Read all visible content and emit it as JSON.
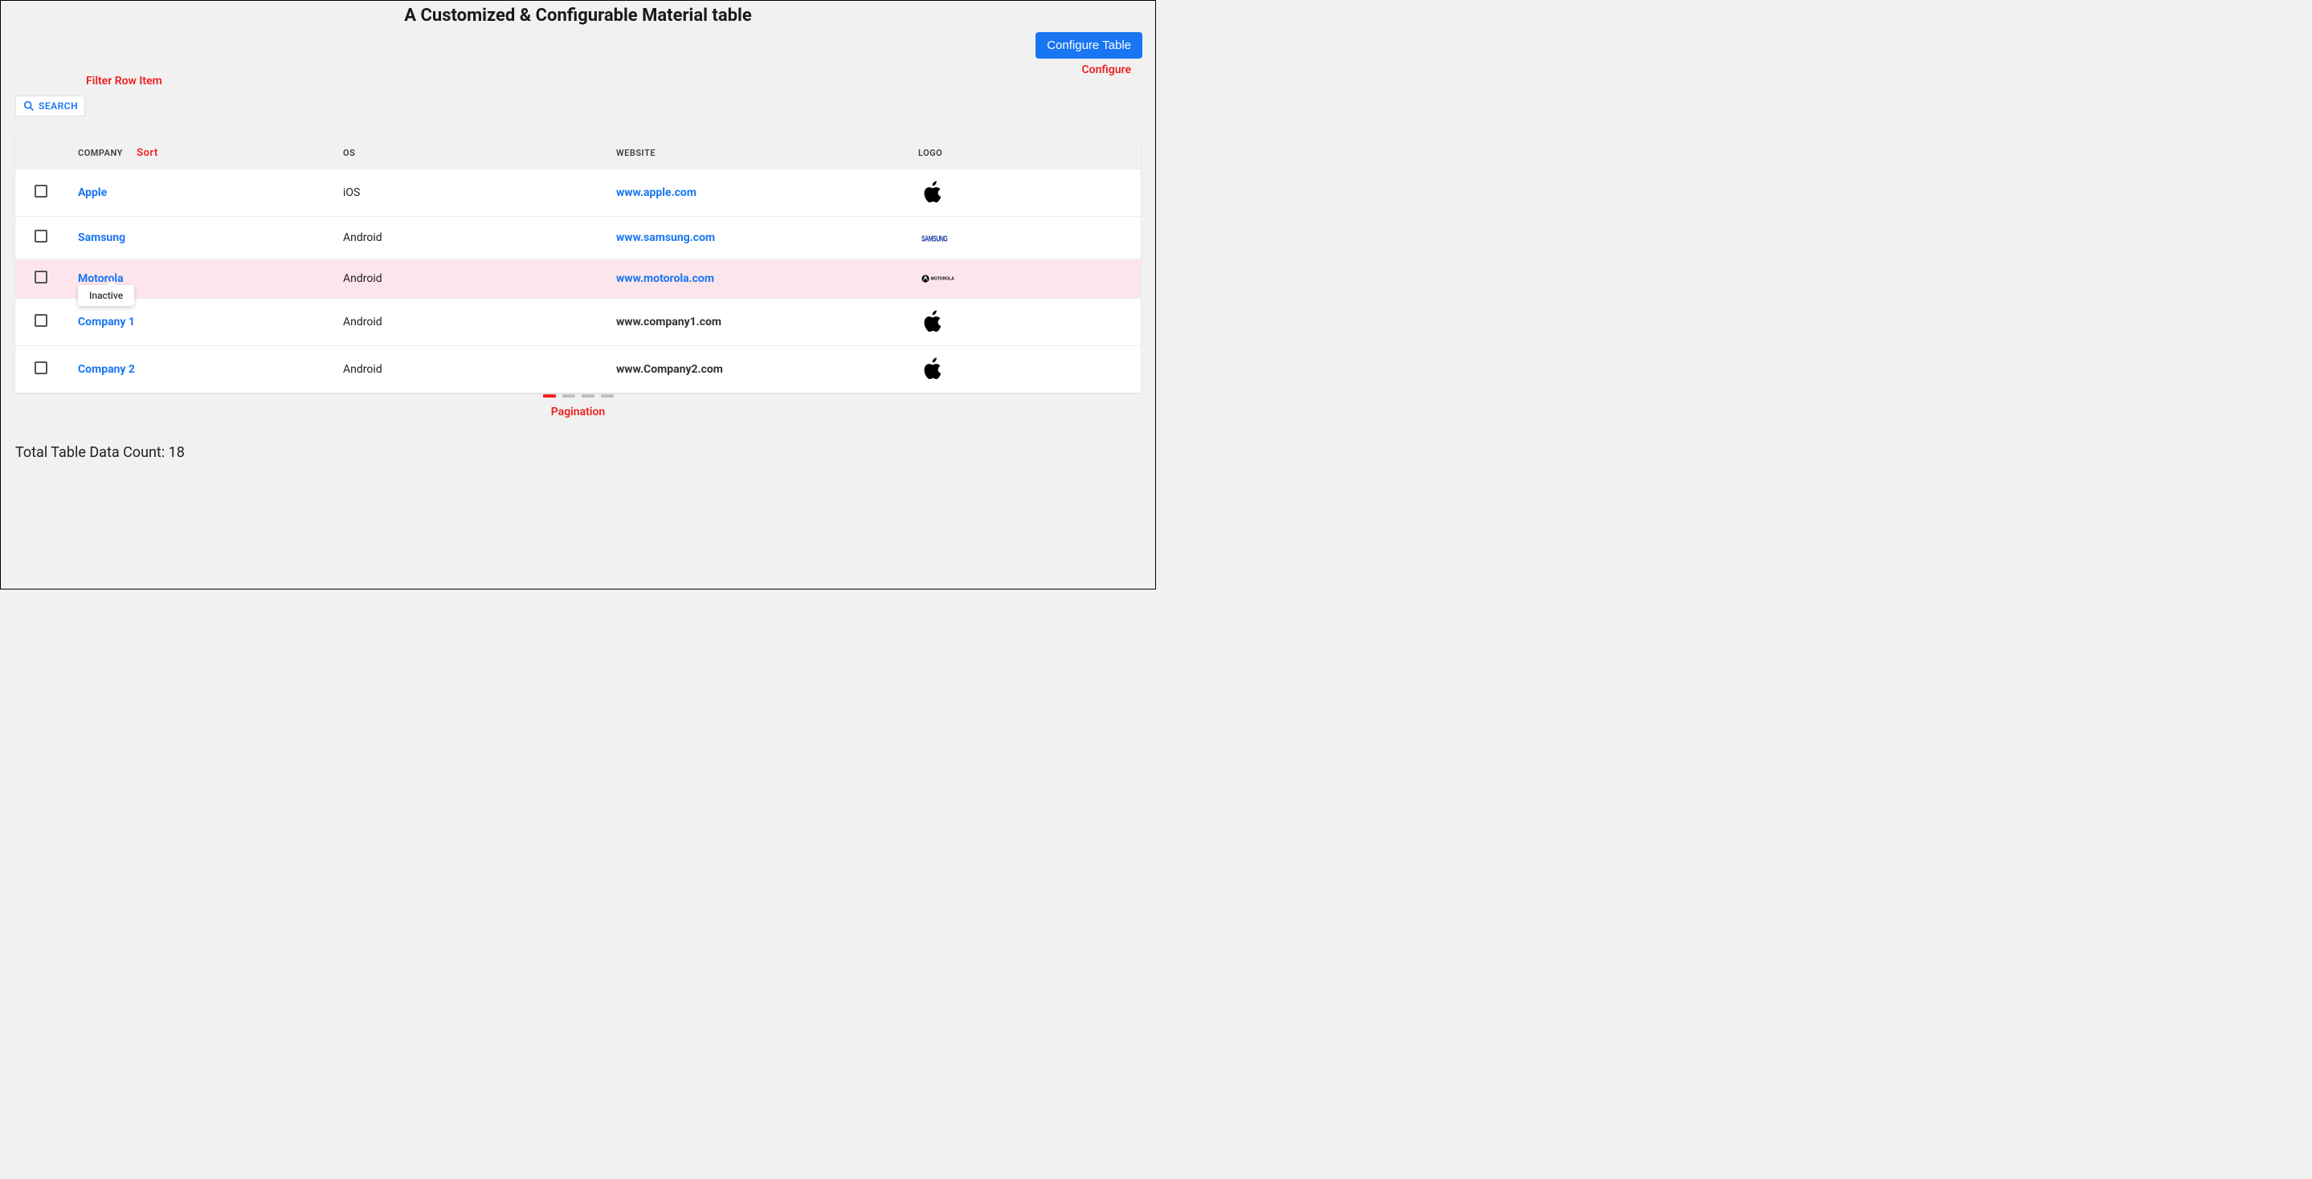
{
  "page": {
    "title": "A Customized & Configurable Material table"
  },
  "toolbar": {
    "configure_label": "Configure Table"
  },
  "annotations": {
    "configure": "Configure",
    "filter": "Filter Row Item",
    "sort": "Sort",
    "pagination": "Pagination"
  },
  "search": {
    "label": "SEARCH"
  },
  "columns": {
    "company": "COMPANY",
    "os": "OS",
    "website": "WEBSITE",
    "logo": "LOGO"
  },
  "rows": [
    {
      "company": "Apple",
      "os": "iOS",
      "website": "www.apple.com",
      "website_linked": true,
      "highlight": false,
      "logo": "apple"
    },
    {
      "company": "Samsung",
      "os": "Android",
      "website": "www.samsung.com",
      "website_linked": true,
      "highlight": false,
      "logo": "samsung"
    },
    {
      "company": "Motorola",
      "os": "Android",
      "website": "www.motorola.com",
      "website_linked": true,
      "highlight": true,
      "logo": "motorola"
    },
    {
      "company": "Company 1",
      "os": "Android",
      "website": "www.company1.com",
      "website_linked": false,
      "highlight": false,
      "logo": "apple"
    },
    {
      "company": "Company 2",
      "os": "Android",
      "website": "www.Company2.com",
      "website_linked": false,
      "highlight": false,
      "logo": "apple"
    }
  ],
  "tooltip": {
    "text": "Inactive",
    "row_index": 3
  },
  "pagination": {
    "pages": 4,
    "active": 0
  },
  "footer": {
    "count_label": "Total Table Data Count: 18"
  }
}
